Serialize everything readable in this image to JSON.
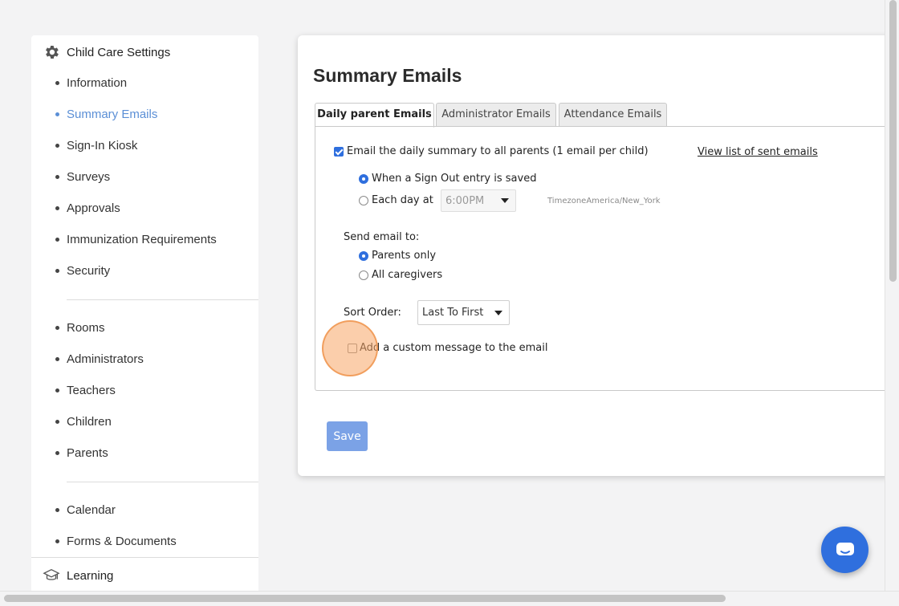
{
  "sidebar": {
    "header": "Child Care Settings",
    "items": [
      {
        "label": "Information"
      },
      {
        "label": "Summary Emails"
      },
      {
        "label": "Sign-In Kiosk"
      },
      {
        "label": "Surveys"
      },
      {
        "label": "Approvals"
      },
      {
        "label": "Immunization Requirements"
      },
      {
        "label": "Security"
      },
      {
        "label": "Rooms"
      },
      {
        "label": "Administrators"
      },
      {
        "label": "Teachers"
      },
      {
        "label": "Children"
      },
      {
        "label": "Parents"
      },
      {
        "label": "Calendar"
      },
      {
        "label": "Forms & Documents"
      }
    ],
    "active_item": "Summary Emails",
    "learning": "Learning"
  },
  "main": {
    "title": "Summary Emails",
    "tabs": [
      {
        "label": "Daily parent Emails",
        "active": true
      },
      {
        "label": "Administrator Emails",
        "active": false
      },
      {
        "label": "Attendance Emails",
        "active": false
      }
    ],
    "daily_summary_checkbox": {
      "label": "Email the daily summary to all parents (1 email per child)",
      "checked": true
    },
    "view_sent_link": "View list of sent emails",
    "timing": {
      "option_sign_out": {
        "label": "When a Sign Out entry is saved",
        "checked": true
      },
      "option_each_day": {
        "label": "Each day at",
        "checked": false
      },
      "time_value": "6:00PM",
      "timezone": "TimezoneAmerica/New_York"
    },
    "send_to": {
      "label": "Send email to:",
      "parents_only": {
        "label": "Parents only",
        "checked": true
      },
      "all_caregivers": {
        "label": "All caregivers",
        "checked": false
      }
    },
    "sort_order": {
      "label": "Sort Order:",
      "value": "Last To First"
    },
    "custom_message_checkbox": {
      "label": "Add a custom message to the email",
      "checked": false
    },
    "save_label": "Save"
  },
  "colors": {
    "accent": "#2f6fde",
    "active_link": "#5b8fd6",
    "save_button": "#7ba2e6",
    "click_highlight": "#f8a566"
  },
  "icons": {
    "sidebar_header": "gear-icon",
    "learning": "graduation-cap-icon",
    "chat": "chat-icon"
  }
}
